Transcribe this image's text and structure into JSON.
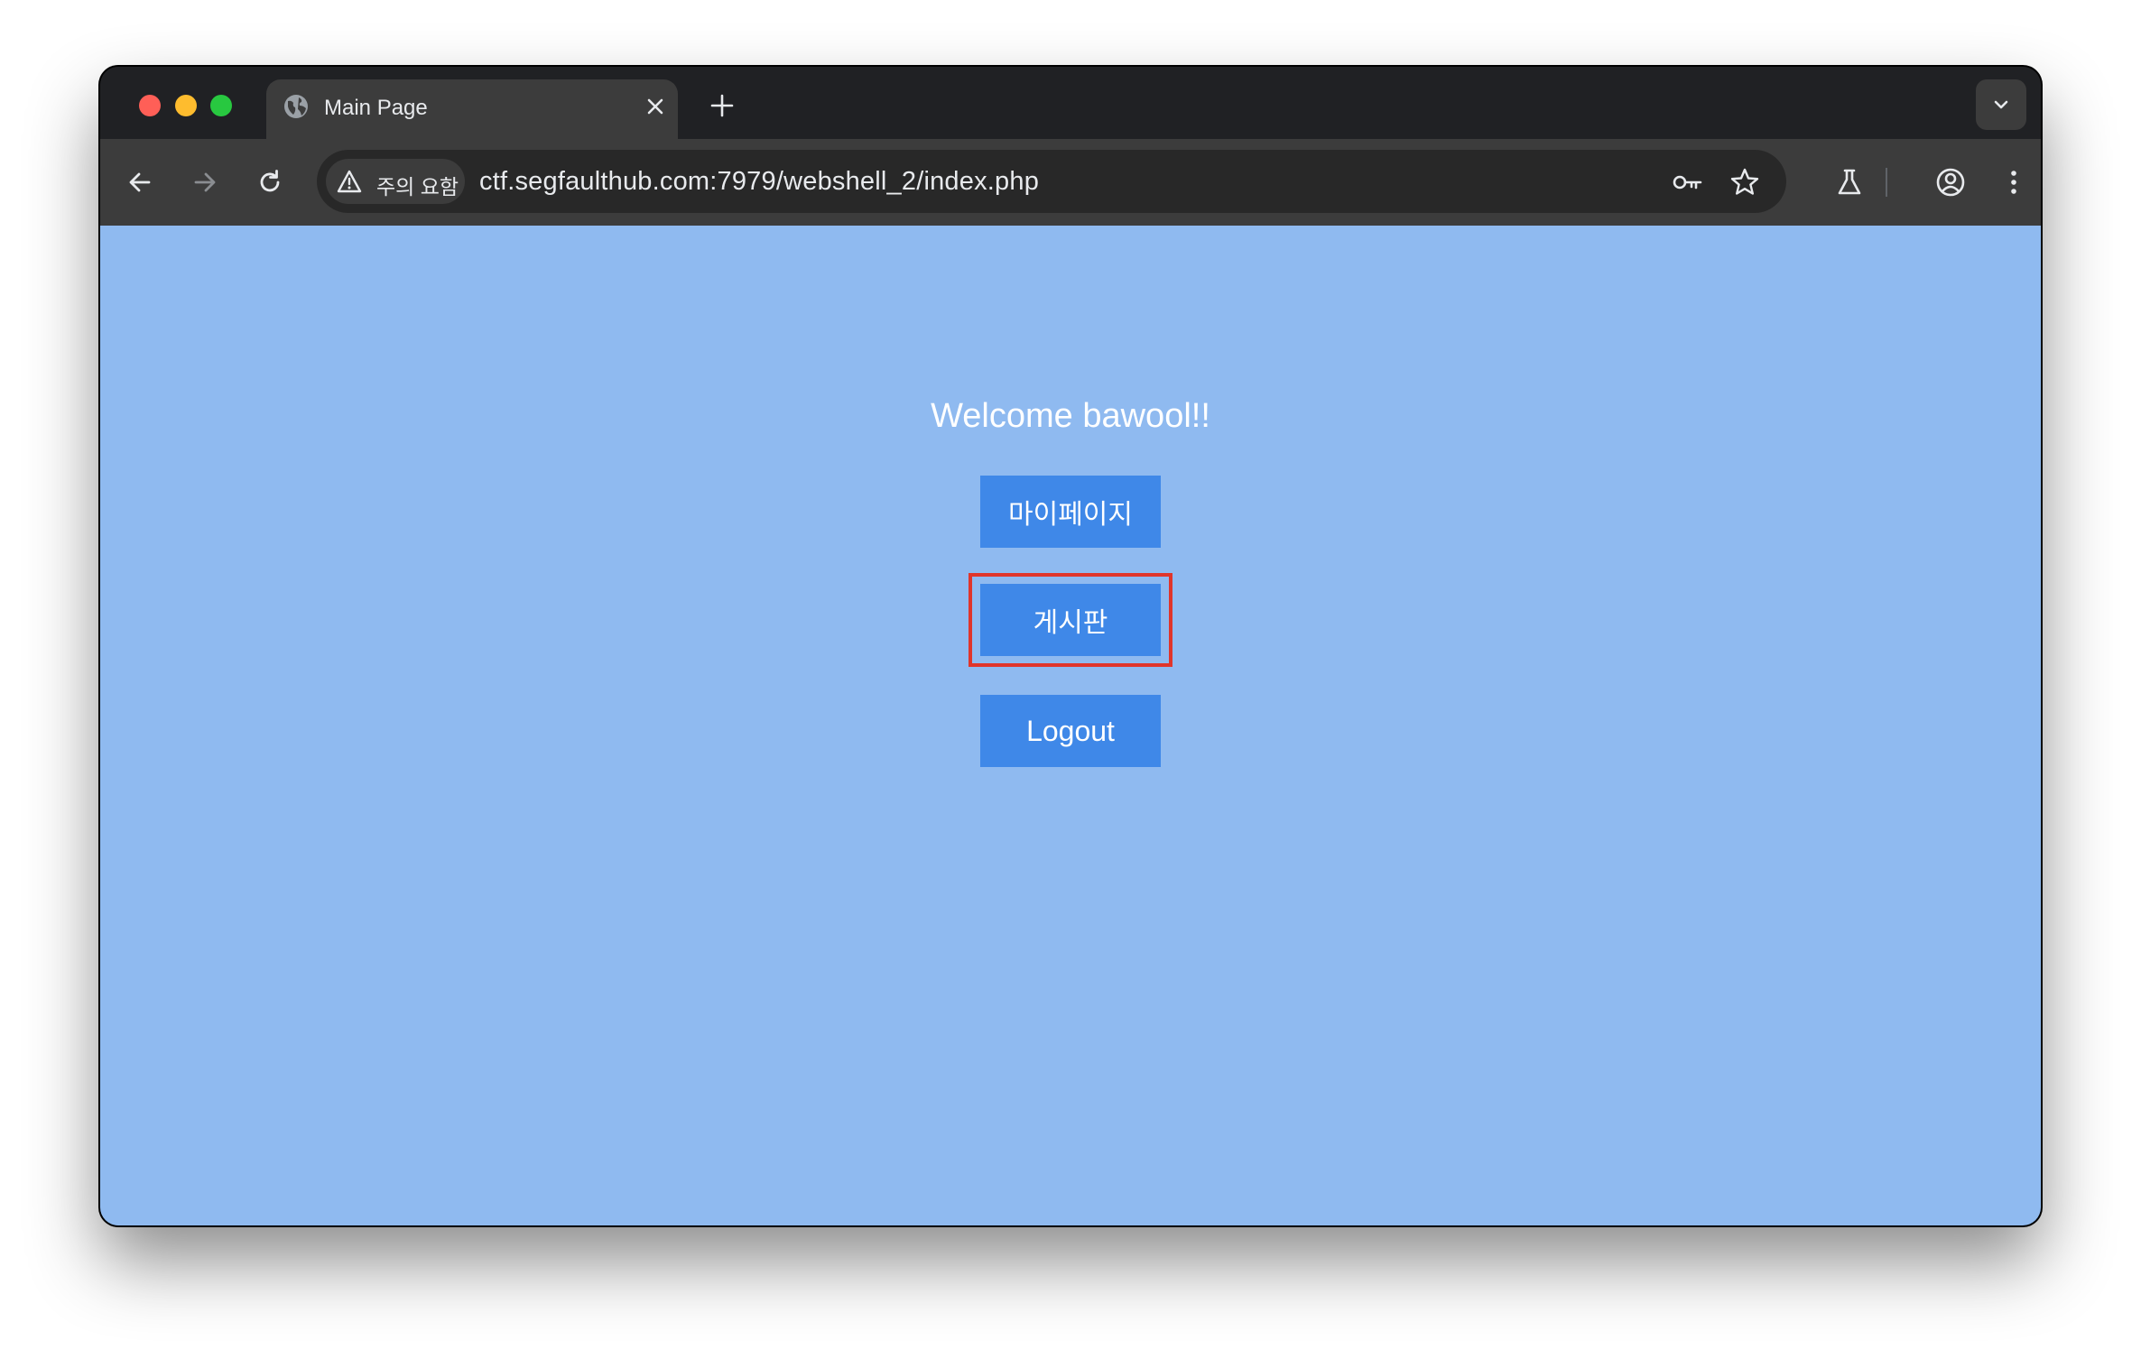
{
  "browser": {
    "tab_title": "Main Page",
    "security_chip_label": "주의 요함",
    "url": "ctf.segfaulthub.com:7979/webshell_2/index.php",
    "icons": {
      "tab_favicon": "globe-icon",
      "tab_close": "close-icon",
      "new_tab": "plus-icon",
      "tab_search": "chevron-down-icon",
      "back": "arrow-left-icon",
      "forward": "arrow-right-icon",
      "reload": "reload-icon",
      "security_warning": "warning-triangle-icon",
      "password_manager": "key-icon",
      "bookmark": "star-icon",
      "labs": "flask-icon",
      "profile": "profile-icon",
      "menu": "kebab-menu-icon"
    },
    "colors": {
      "window_bg": "#202124",
      "toolbar_bg": "#3c3c3c",
      "omnibox_bg": "#282828"
    }
  },
  "page": {
    "welcome_text": "Welcome bawool!!",
    "buttons": {
      "mypage_label": "마이페이지",
      "board_label": "게시판",
      "logout_label": "Logout"
    },
    "colors": {
      "background": "#8fbaf0",
      "button": "#3f88e8",
      "highlight": "#e0352b"
    }
  }
}
